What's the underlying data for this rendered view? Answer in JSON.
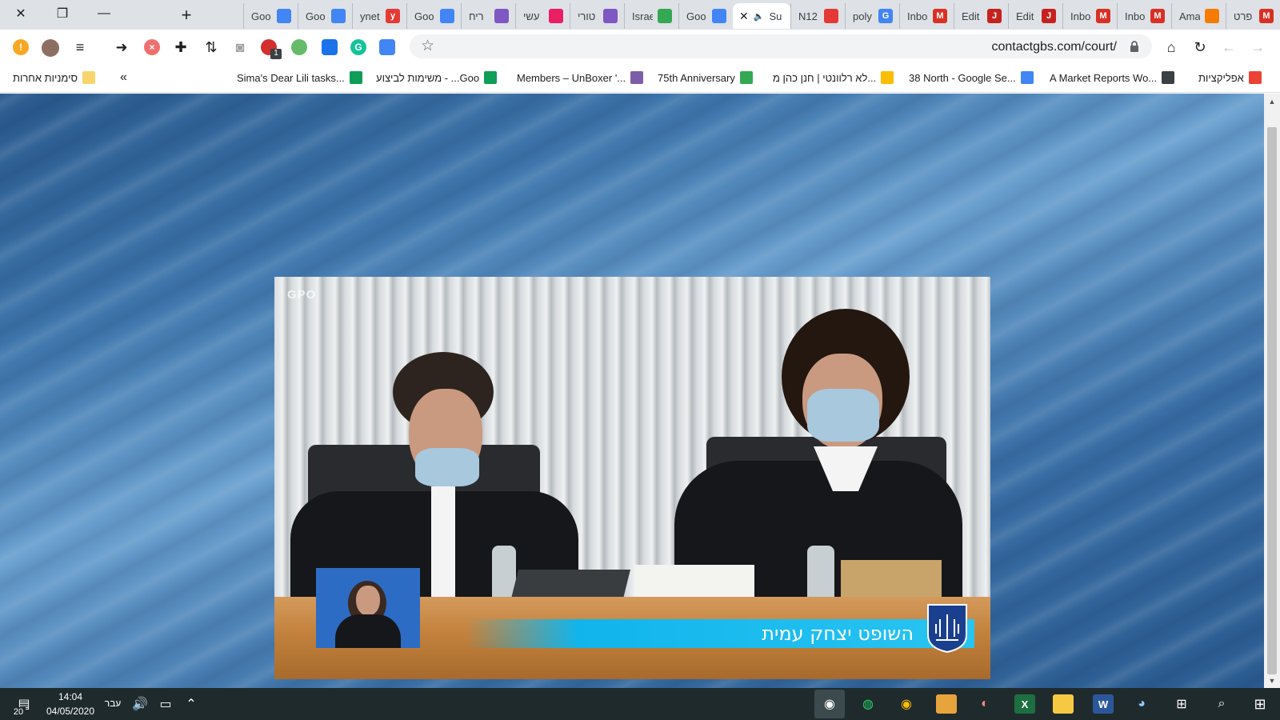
{
  "browser": {
    "window_controls": {
      "close": "✕",
      "restore": "❐",
      "minimize": "—"
    },
    "new_tab_glyph": "+",
    "tabs": [
      {
        "title": "פרט",
        "fav": "M",
        "color": "#d93025"
      },
      {
        "title": "Ama",
        "fav": "",
        "color": "#f57c00"
      },
      {
        "title": "Inbo",
        "fav": "M",
        "color": "#d93025"
      },
      {
        "title": "Inbo",
        "fav": "M",
        "color": "#d93025"
      },
      {
        "title": "Edit",
        "fav": "J",
        "color": "#c5221f"
      },
      {
        "title": "Edit",
        "fav": "J",
        "color": "#c5221f"
      },
      {
        "title": "Inbo",
        "fav": "M",
        "color": "#d93025"
      },
      {
        "title": "poly",
        "fav": "G",
        "color": "#4285f4"
      },
      {
        "title": "N12",
        "fav": "",
        "color": "#e53935"
      },
      {
        "title": "Su",
        "fav": "",
        "color": "#ffffff",
        "active": true
      },
      {
        "title": "Goo",
        "fav": "",
        "color": "#4285f4"
      },
      {
        "title": "Israe",
        "fav": "",
        "color": "#34a853"
      },
      {
        "title": "טורי",
        "fav": "",
        "color": "#7e57c2"
      },
      {
        "title": "עשי",
        "fav": "",
        "color": "#e91e63"
      },
      {
        "title": "ריח",
        "fav": "",
        "color": "#7e57c2"
      },
      {
        "title": "Goo",
        "fav": "",
        "color": "#4285f4"
      },
      {
        "title": "ynet",
        "fav": "y",
        "color": "#e53935"
      },
      {
        "title": "Goo",
        "fav": "",
        "color": "#4285f4"
      },
      {
        "title": "Goo",
        "fav": "",
        "color": "#4285f4"
      }
    ],
    "url": "contactgbs.com/court/",
    "extension_badge": "1",
    "bookmarks": [
      {
        "label": "אפליקציות",
        "color": "#ea4335"
      },
      {
        "label": "A Market Reports Wo...",
        "color": "#3c4043"
      },
      {
        "label": "38 North - Google Se...",
        "color": "#4285f4"
      },
      {
        "label": "לא רלוונטי | חנן כהן מ...",
        "color": "#fbbc04"
      },
      {
        "label": "75th Anniversary",
        "color": "#34a853"
      },
      {
        "label": "Members – UnBoxer '...",
        "color": "#7b5ea7"
      },
      {
        "label": "משימות לביצוע - ...Goo",
        "color": "#0f9d58"
      },
      {
        "label": "Sima's Dear Lili tasks...",
        "color": "#0f9d58"
      }
    ],
    "bookmarks_overflow": "«",
    "other_bookmarks": "סימניות אחרות"
  },
  "video": {
    "watermark": "GPO",
    "caption": "השופט יצחק עמית"
  },
  "taskbar": {
    "notification_count": "20",
    "time": "14:04",
    "date": "04/05/2020",
    "language": "עבר"
  }
}
